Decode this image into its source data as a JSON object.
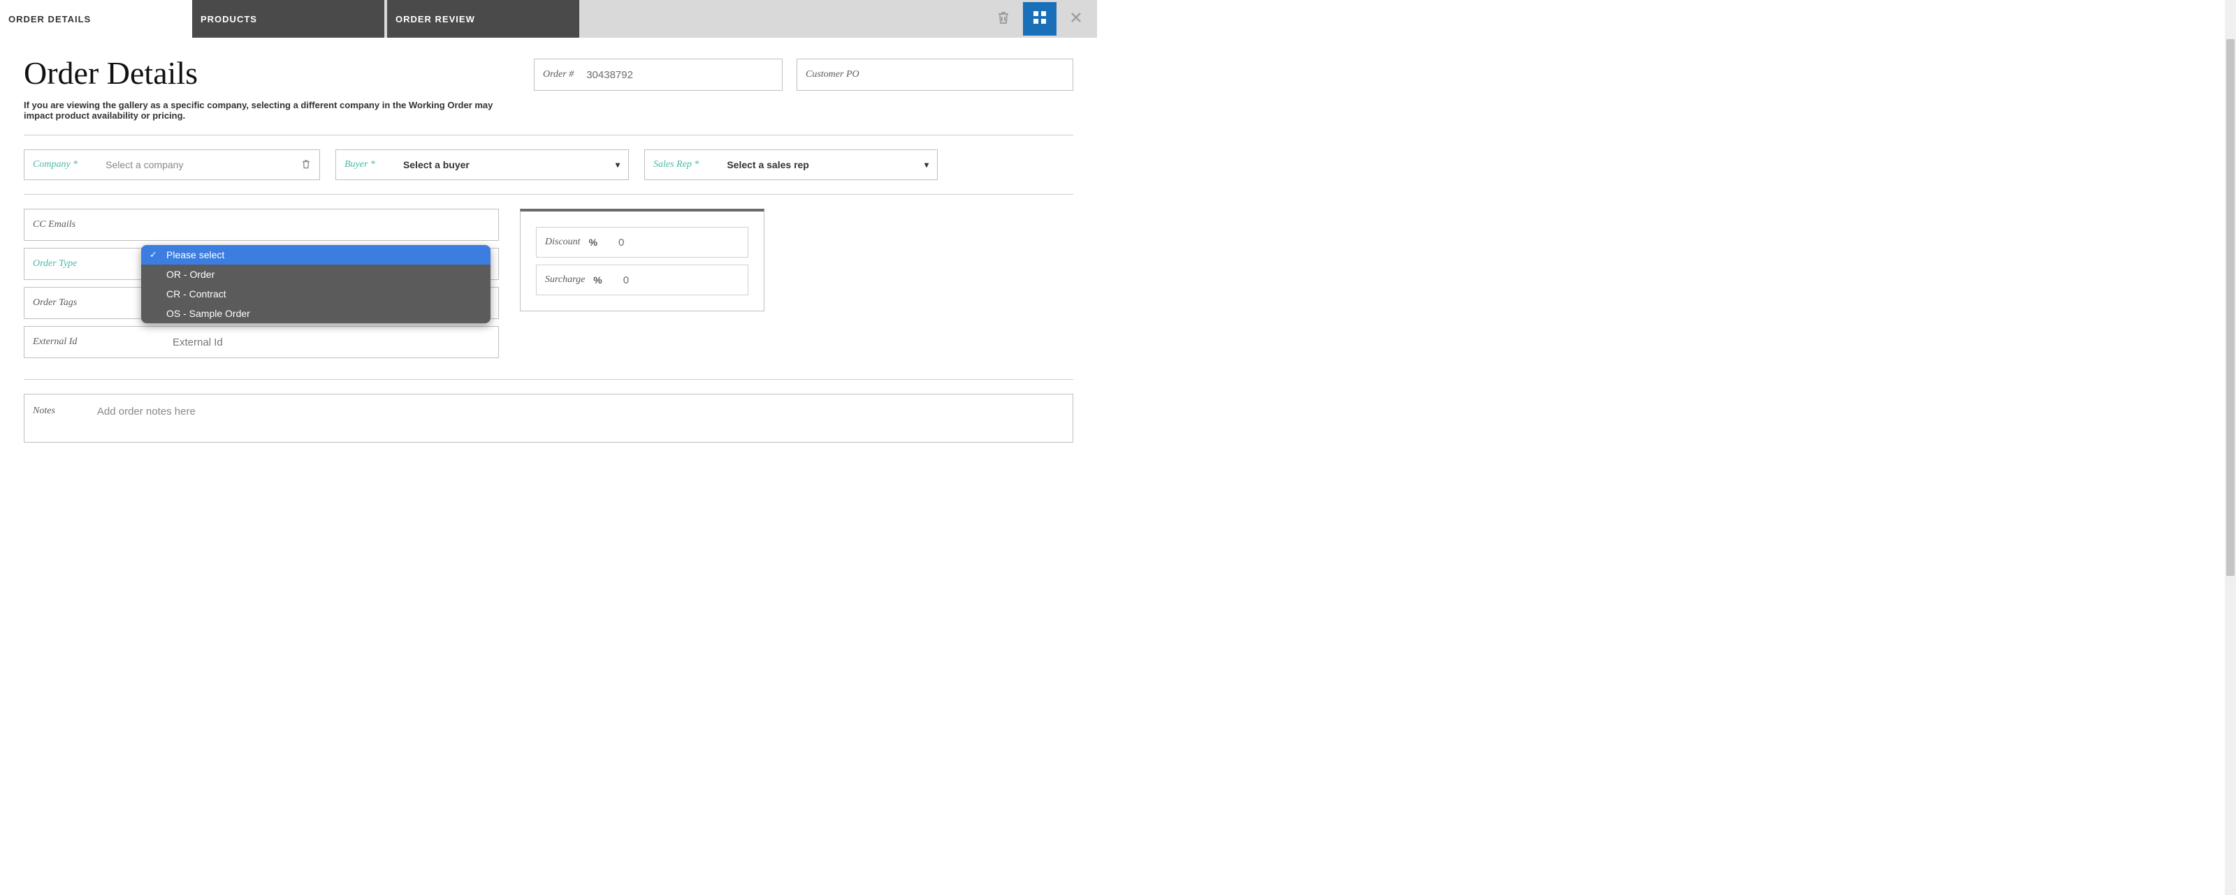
{
  "tabs": {
    "order_details": "ORDER DETAILS",
    "products": "PRODUCTS",
    "order_review": "ORDER REVIEW"
  },
  "page": {
    "title": "Order Details",
    "subtitle": "If you are viewing the gallery as a specific company, selecting a different company in the Working Order may impact product availability or pricing."
  },
  "header_fields": {
    "order_number_label": "Order #",
    "order_number_value": "30438792",
    "customer_po_label": "Customer PO",
    "customer_po_value": ""
  },
  "selectors": {
    "company_label": "Company *",
    "company_placeholder": "Select a company",
    "buyer_label": "Buyer *",
    "buyer_placeholder": "Select a buyer",
    "salesrep_label": "Sales Rep *",
    "salesrep_placeholder": "Select a sales rep"
  },
  "fields": {
    "cc_emails_label": "CC Emails",
    "cc_emails_value": "",
    "order_type_label": "Order Type",
    "order_tags_label": "Order Tags",
    "external_id_label": "External Id",
    "external_id_placeholder": "External Id"
  },
  "order_type_options": [
    {
      "label": "Please select",
      "selected": true
    },
    {
      "label": "OR - Order",
      "selected": false
    },
    {
      "label": "CR - Contract",
      "selected": false
    },
    {
      "label": "OS - Sample Order",
      "selected": false
    }
  ],
  "pricing": {
    "discount_label": "Discount",
    "discount_unit": "%",
    "discount_value": "0",
    "surcharge_label": "Surcharge",
    "surcharge_unit": "%",
    "surcharge_value": "0"
  },
  "notes": {
    "label": "Notes",
    "placeholder": "Add order notes here"
  }
}
